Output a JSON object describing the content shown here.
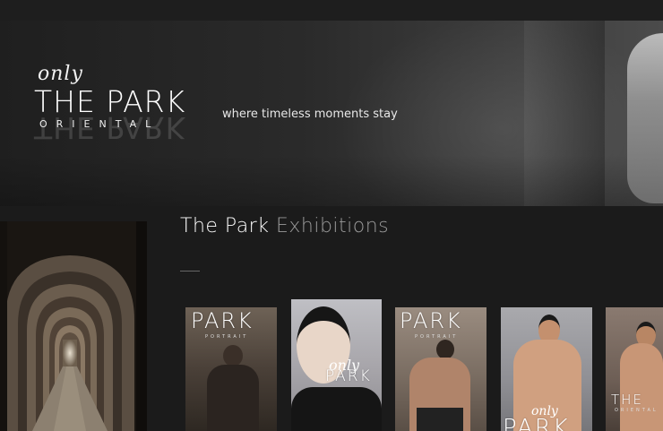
{
  "hero": {
    "logo_script": "only",
    "logo_title": "THE PARK",
    "logo_subtitle": "ORIENTAL",
    "tagline": "where timeless moments stay"
  },
  "section": {
    "title_part1": "The Park",
    "title_part2": "Exhibitions"
  },
  "cards": [
    {
      "title": "PARK",
      "subtitle": "PORTRAIT"
    },
    {
      "script": "only",
      "title": "PARK"
    },
    {
      "title": "PARK",
      "subtitle": "PORTRAIT"
    },
    {
      "script": "only",
      "title": "PARK"
    },
    {
      "title": "THE",
      "subtitle": "ORIENTAL"
    }
  ],
  "colors": {
    "background": "#1b1b1b",
    "title_accent": "#9a9a9a"
  }
}
